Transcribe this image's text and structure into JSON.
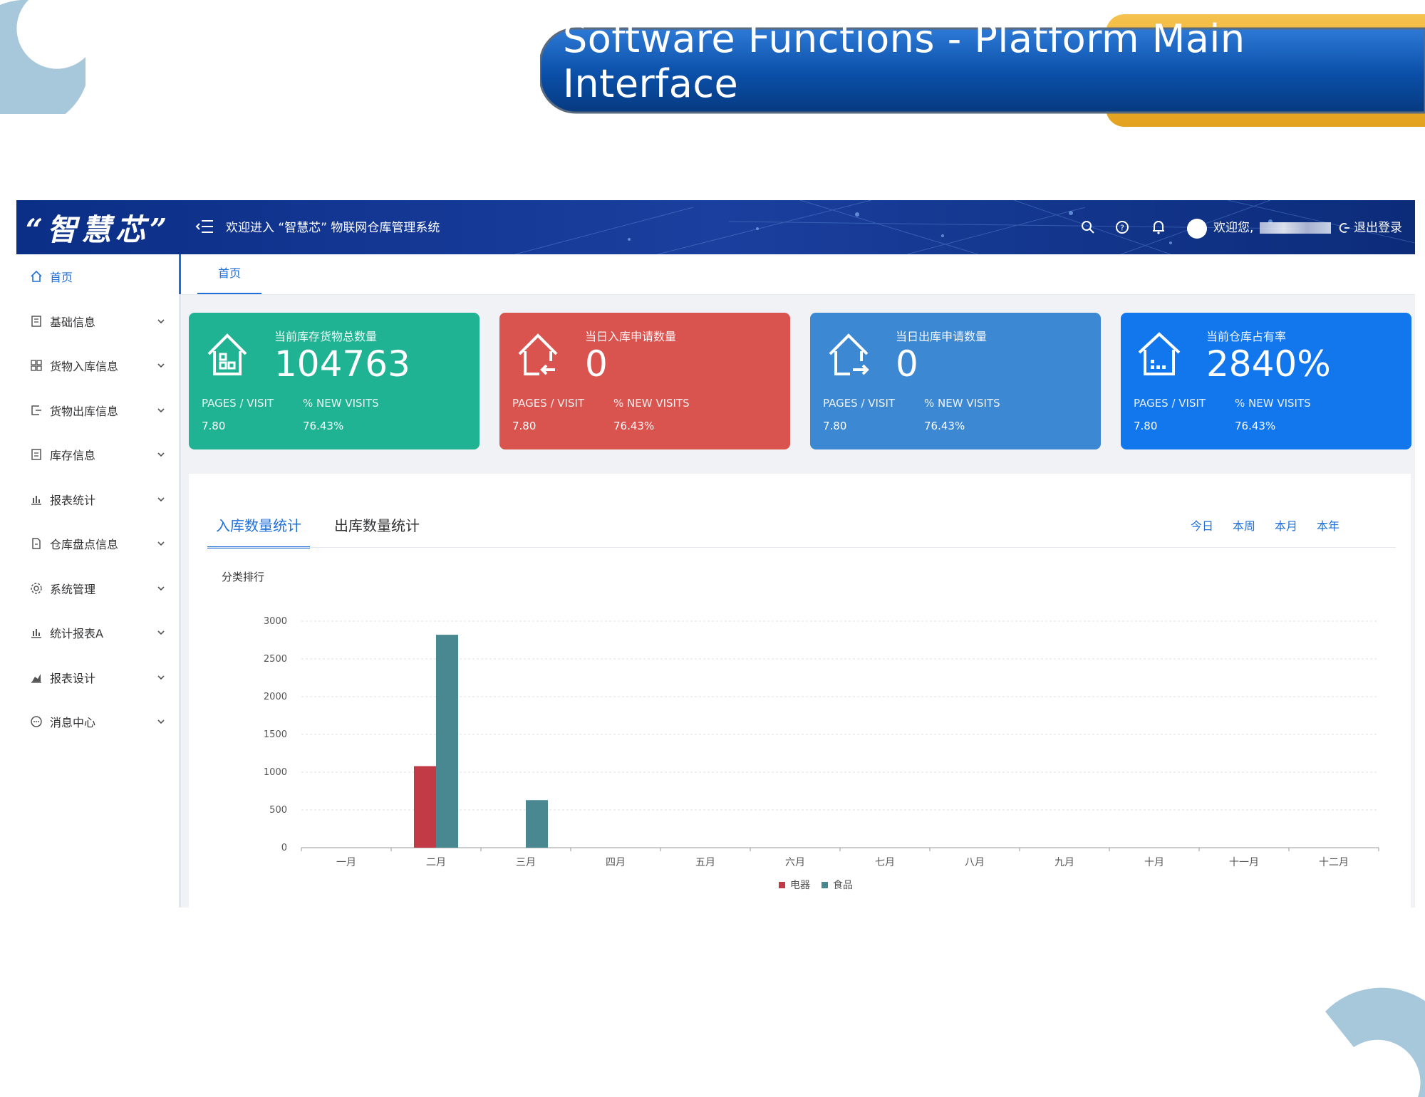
{
  "slide": {
    "title": "Software Functions - Platform Main Interface"
  },
  "header": {
    "logo": "“智慧芯”",
    "welcome": "欢迎进入 “智慧芯” 物联网仓库管理系统",
    "greeting": "欢迎您,",
    "logout": "退出登录"
  },
  "sidebar": {
    "items": [
      {
        "label": "首页",
        "icon": "home-icon"
      },
      {
        "label": "基础信息",
        "icon": "document-icon"
      },
      {
        "label": "货物入库信息",
        "icon": "grid-icon"
      },
      {
        "label": "货物出库信息",
        "icon": "exit-icon"
      },
      {
        "label": "库存信息",
        "icon": "list-icon"
      },
      {
        "label": "报表统计",
        "icon": "bar-chart-icon"
      },
      {
        "label": "仓库盘点信息",
        "icon": "file-icon"
      },
      {
        "label": "系统管理",
        "icon": "gear-icon"
      },
      {
        "label": "统计报表A",
        "icon": "bar-chart-icon"
      },
      {
        "label": "报表设计",
        "icon": "area-chart-icon"
      },
      {
        "label": "消息中心",
        "icon": "message-icon"
      }
    ]
  },
  "tabs": {
    "home": "首页"
  },
  "cards": [
    {
      "title": "当前库存货物总数量",
      "value": "104763",
      "label1": "PAGES / VISIT",
      "label2": "% NEW VISITS",
      "val1": "7.80",
      "val2": "76.43%",
      "color": "#1fb394"
    },
    {
      "title": "当日入库申请数量",
      "value": "0",
      "label1": "PAGES / VISIT",
      "label2": "% NEW VISITS",
      "val1": "7.80",
      "val2": "76.43%",
      "color": "#d9534f"
    },
    {
      "title": "当日出库申请数量",
      "value": "0",
      "label1": "PAGES / VISIT",
      "label2": "% NEW VISITS",
      "val1": "7.80",
      "val2": "76.43%",
      "color": "#3d88d3"
    },
    {
      "title": "当前仓库占有率",
      "value": "2840%",
      "label1": "PAGES / VISIT",
      "label2": "% NEW VISITS",
      "val1": "7.80",
      "val2": "76.43%",
      "color": "#1276ed"
    }
  ],
  "panel": {
    "tab_in": "入库数量统计",
    "tab_out": "出库数量统计",
    "ranges": [
      "今日",
      "本周",
      "本月",
      "本年"
    ]
  },
  "chart_data": {
    "type": "bar",
    "title": "分类排行",
    "categories": [
      "一月",
      "二月",
      "三月",
      "四月",
      "五月",
      "六月",
      "七月",
      "八月",
      "九月",
      "十月",
      "十一月",
      "十二月"
    ],
    "series": [
      {
        "name": "电器",
        "color": "#c23a45",
        "values": [
          0,
          1080,
          0,
          0,
          0,
          0,
          0,
          0,
          0,
          0,
          0,
          0
        ]
      },
      {
        "name": "食品",
        "color": "#4a8891",
        "values": [
          0,
          2820,
          630,
          0,
          0,
          0,
          0,
          0,
          0,
          0,
          0,
          0
        ]
      }
    ],
    "ylim": [
      0,
      3000
    ],
    "yticks": [
      "3000",
      "2500",
      "2000",
      "1500",
      "1000",
      "500",
      "0"
    ],
    "grid": true,
    "legend": "bottom-center"
  }
}
